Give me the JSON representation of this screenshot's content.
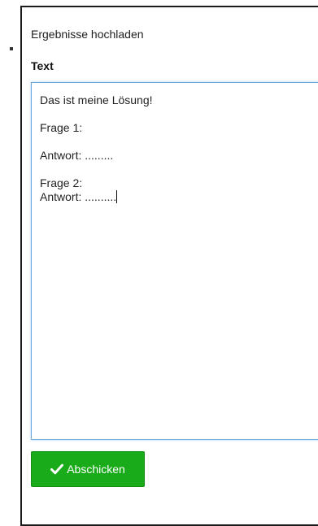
{
  "panel": {
    "title": "Ergebnisse hochladen"
  },
  "field": {
    "label": "Text",
    "lines": [
      "Das ist meine Lösung!",
      "",
      "Frage 1:",
      "",
      "Antwort: .........",
      "",
      "Frage 2:",
      "Antwort: .........."
    ]
  },
  "submit": {
    "label": "Abschicken",
    "icon": "check-icon",
    "color": "#1aab1a"
  }
}
